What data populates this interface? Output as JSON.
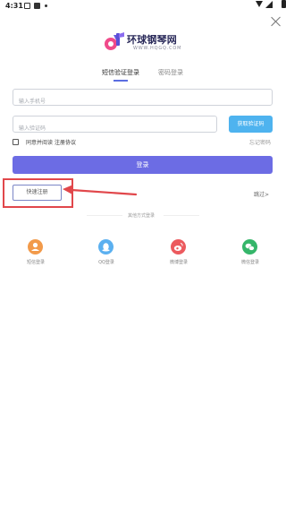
{
  "status_bar": {
    "time": "4:31"
  },
  "logo": {
    "name": "环球钢琴网",
    "url": "WWW.HQGQ.COM"
  },
  "tabs": [
    {
      "label": "短信验证登录",
      "active": true
    },
    {
      "label": "密码登录",
      "active": false
    }
  ],
  "form": {
    "phone_placeholder": "输入手机号",
    "code_placeholder": "输入验证码",
    "get_code_label": "获取验证码",
    "agree_text": "同意并阅读",
    "agreement_link": "注册协议",
    "forgot_label": "忘记密码",
    "login_label": "登录"
  },
  "quick_register_label": "快速注册",
  "skip_label": "跳过>",
  "other_methods_label": "其他方式登录",
  "social": [
    {
      "label": "短信登录",
      "icon": "person-icon",
      "color": "#f29a4a"
    },
    {
      "label": "QQ登录",
      "icon": "qq-icon",
      "color": "#5bb0f0"
    },
    {
      "label": "微博登录",
      "icon": "weibo-icon",
      "color": "#ec5a5e"
    },
    {
      "label": "微信登录",
      "icon": "wechat-icon",
      "color": "#35b66a"
    }
  ],
  "colors": {
    "primary": "#6c6ce4",
    "get_code": "#4eb3ef",
    "tab_underline": "#5b6ee1",
    "annotation": "#e1474b"
  }
}
